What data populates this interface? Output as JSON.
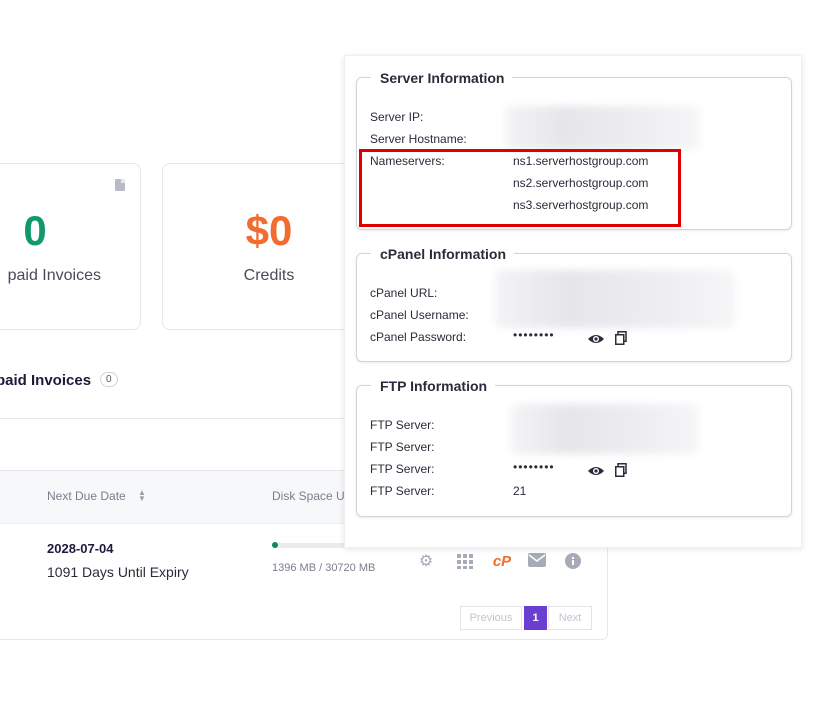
{
  "stats": [
    {
      "value": "0",
      "label": "paid Invoices",
      "color": "#0f9a68"
    },
    {
      "value": "$0",
      "label": "Credits",
      "color": "#f26b2f"
    }
  ],
  "unpaid_section": {
    "title": "paid Invoices",
    "count": "0"
  },
  "table": {
    "columns": [
      "Next Due Date",
      "Disk Space U"
    ],
    "row": {
      "due_date": "2028-07-04",
      "expiry": "1091 Days Until Expiry",
      "disk": "1396 MB / 30720 MB",
      "disk_fraction": 0.045
    },
    "icons": [
      "gear-icon",
      "grid-icon",
      "cpanel-icon",
      "mail-icon",
      "info-icon"
    ]
  },
  "pagination": {
    "previous": "Previous",
    "current": "1",
    "next": "Next"
  },
  "server_info": {
    "legend": "Server Information",
    "ip_label": "Server IP:",
    "hostname_label": "Server Hostname:",
    "nameservers_label": "Nameservers:",
    "nameservers": [
      "ns1.serverhostgroup.com",
      "ns2.serverhostgroup.com",
      "ns3.serverhostgroup.com"
    ]
  },
  "cpanel_info": {
    "legend": "cPanel Information",
    "url_label": "cPanel URL:",
    "username_label": "cPanel Username:",
    "password_label": "cPanel Password:",
    "password_mask": "••••••••"
  },
  "ftp_info": {
    "legend": "FTP Information",
    "labels": [
      "FTP Server:",
      "FTP Server:",
      "FTP Server:",
      "FTP Server:"
    ],
    "password_mask": "••••••••",
    "port": "21"
  },
  "colors": {
    "accent": "#6a3fd0",
    "highlight": "#e00000"
  }
}
